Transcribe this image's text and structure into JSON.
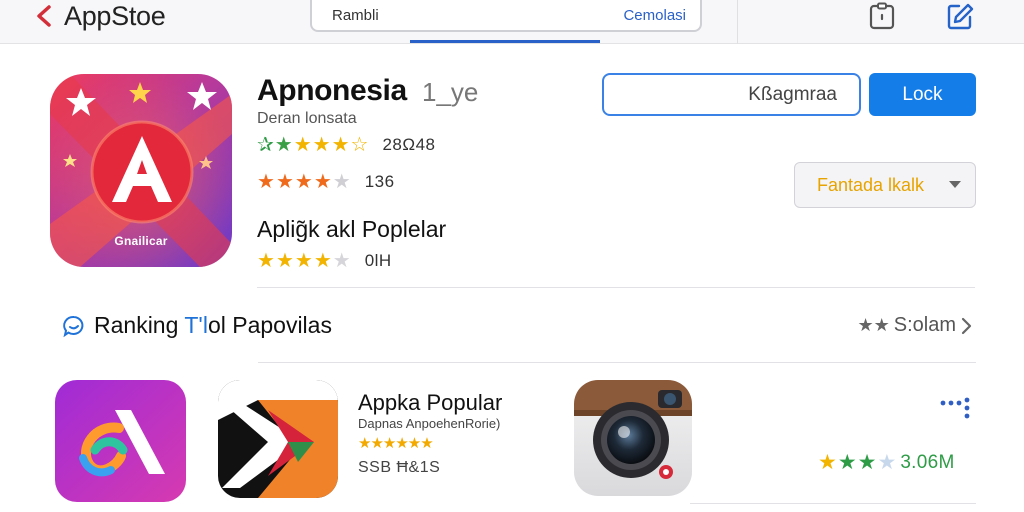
{
  "topbar": {
    "back_label": "AppStoe",
    "search_query": "Rambli",
    "search_button": "Cemolasi"
  },
  "hero": {
    "icon_caption": "Gnailicar",
    "name": "Apnonesia",
    "name_suffix": "1_уe",
    "developer": "Deran lonsata",
    "ratings": [
      {
        "value": "28Ω48"
      },
      {
        "value": "136"
      }
    ],
    "popular_title": "Aplig̃k  akl Poplelar",
    "popular_rating": "0lH",
    "field_label": "Kßagmraa",
    "primary_button": "Lock",
    "select_value": "Fantada lkalk"
  },
  "ranking": {
    "title_prefix": "Ranking ",
    "title_accent": "T'l",
    "title_suffix": "ol Papovilas",
    "see_all_stars": "★★",
    "see_all_label": "S:olam"
  },
  "list_item": {
    "title": "Appka Popular",
    "subtitle": "Dapnas AnpoehenRorie)",
    "stars": "★★★★★★",
    "meta": "SSB Ħ&1S",
    "rating": "3.06M"
  },
  "colors": {
    "accent_blue": "#157de8",
    "star_gold": "#f2b400",
    "star_orange": "#f06a1c",
    "star_green": "#2e9c46"
  }
}
